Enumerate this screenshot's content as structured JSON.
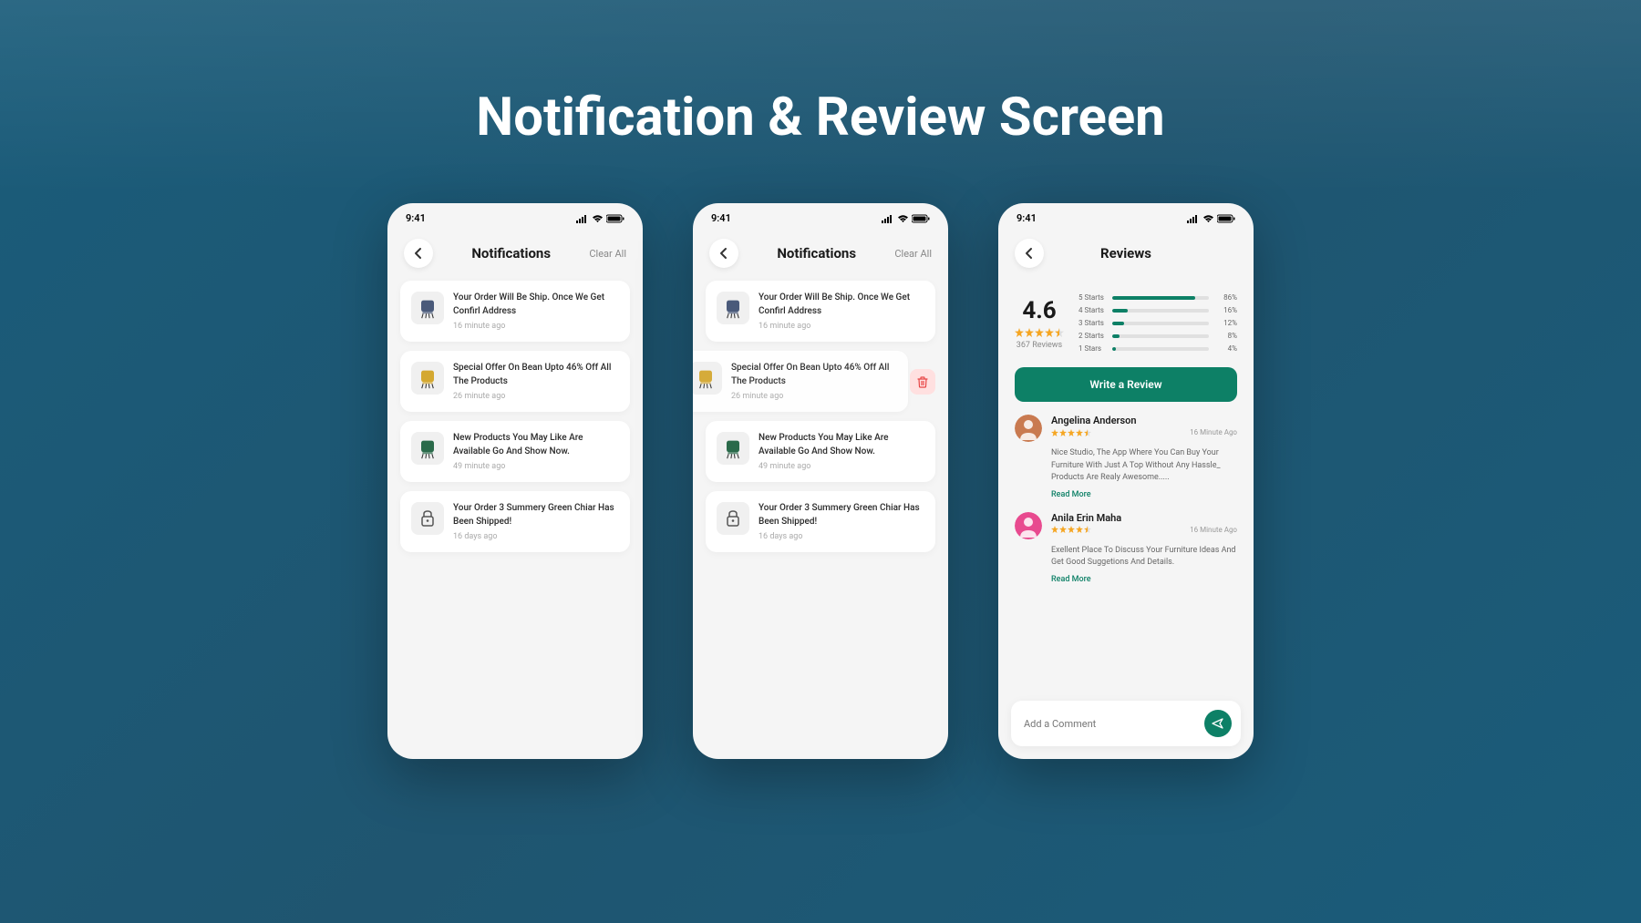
{
  "pageTitle": "Notification & Review Screen",
  "statusBar": {
    "time": "9:41"
  },
  "notifications": {
    "headerTitle": "Notifications",
    "clearAll": "Clear All",
    "items": [
      {
        "title": "Your Order Will Be Ship. Once We Get Confirl Address",
        "time": "16 minute ago",
        "icon": "chair-blue"
      },
      {
        "title": "Special Offer On Bean Upto 46% Off All The Products",
        "time": "26 minute ago",
        "icon": "chair-yellow"
      },
      {
        "title": "New Products You May Like Are Available Go And Show Now.",
        "time": "49 minute ago",
        "icon": "chair-green"
      },
      {
        "title": "Your Order 3 Summery Green Chiar Has Been Shipped!",
        "time": "16 days ago",
        "icon": "lock"
      }
    ]
  },
  "reviews": {
    "headerTitle": "Reviews",
    "score": "4.6",
    "count": "367 Reviews",
    "bars": [
      {
        "label": "5 Starts",
        "pct": "86%",
        "width": 86
      },
      {
        "label": "4 Starts",
        "pct": "16%",
        "width": 16
      },
      {
        "label": "3 Starts",
        "pct": "12%",
        "width": 12
      },
      {
        "label": "2 Starts",
        "pct": "8%",
        "width": 8
      },
      {
        "label": "1 Stars",
        "pct": "4%",
        "width": 4
      }
    ],
    "writeReview": "Write a Review",
    "items": [
      {
        "name": "Angelina Anderson",
        "time": "16 Minute Ago",
        "text": "Nice Studio, The App Where You Can Buy Your Furniture With Just A Top Without Any Hassle_ Products Are Realy Awesome.....",
        "readMore": "Read More",
        "avatarColor": "#c97a50"
      },
      {
        "name": "Anila Erin Maha",
        "time": "16 Minute Ago",
        "text": "Exellent Place To Discuss Your Furniture Ideas And Get Good Suggetions And Details.",
        "readMore": "Read More",
        "avatarColor": "#e84a8f"
      }
    ],
    "commentPlaceholder": "Add a Comment"
  }
}
